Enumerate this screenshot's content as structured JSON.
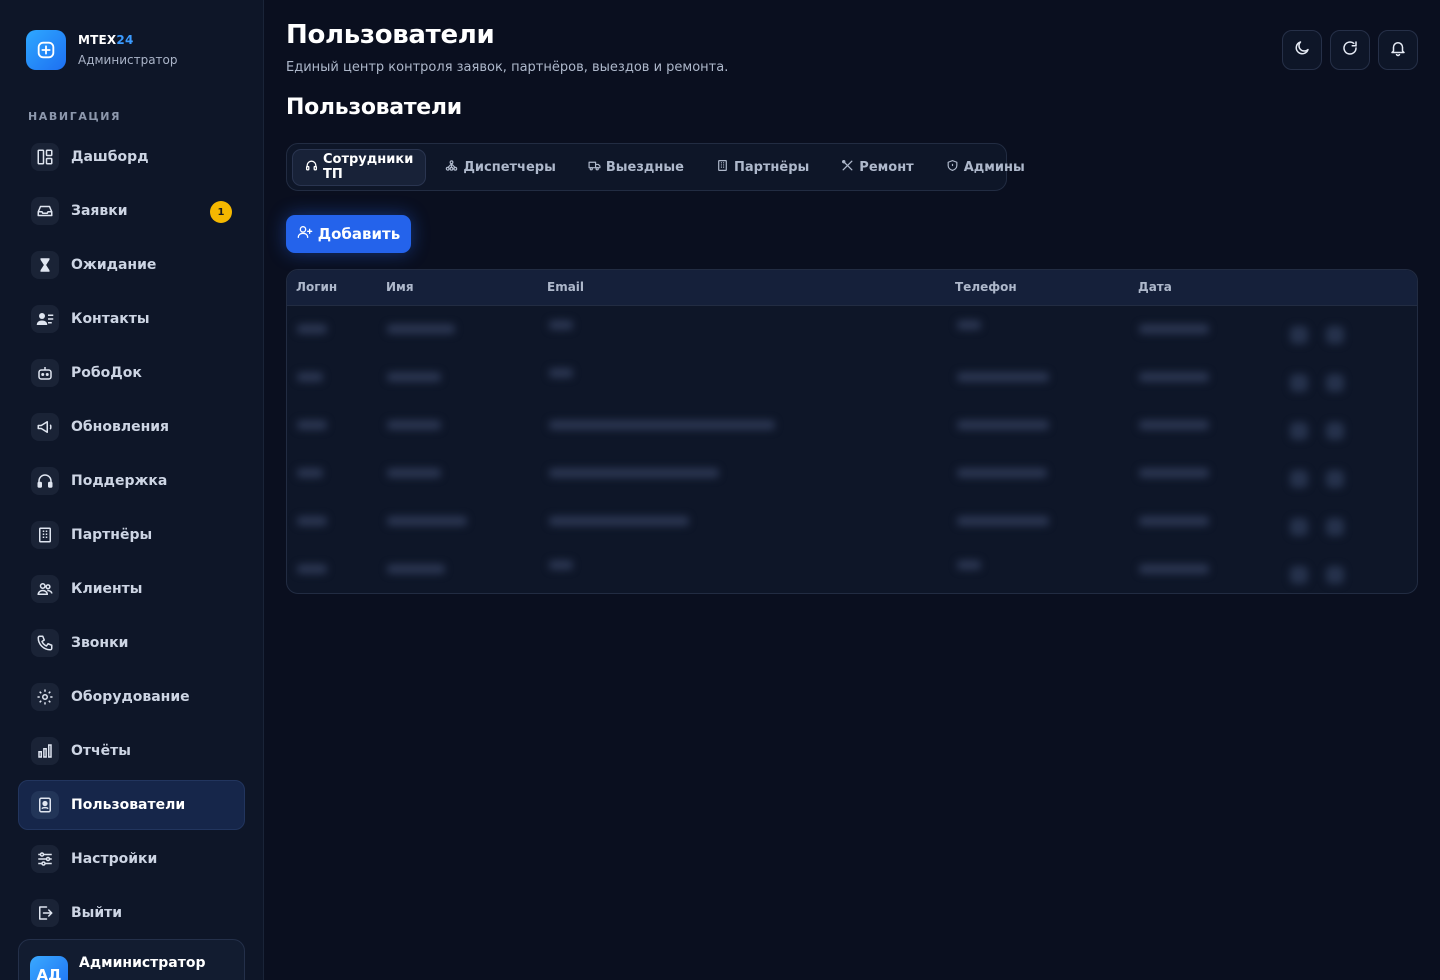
{
  "brand": {
    "name_main": "MTEX",
    "name_accent": "24",
    "role": "Администратор",
    "accent_color": "#3b9bff"
  },
  "sidebar": {
    "nav_title": "НАВИГАЦИЯ",
    "items": [
      {
        "label": "Дашборд",
        "icon": "dashboard-icon"
      },
      {
        "label": "Заявки",
        "icon": "inbox-icon",
        "badge": "1"
      },
      {
        "label": "Ожидание",
        "icon": "hourglass-icon"
      },
      {
        "label": "Контакты",
        "icon": "contacts-icon"
      },
      {
        "label": "РобоДок",
        "icon": "robot-icon"
      },
      {
        "label": "Обновления",
        "icon": "megaphone-icon"
      },
      {
        "label": "Поддержка",
        "icon": "headset-icon"
      },
      {
        "label": "Партнёры",
        "icon": "building-icon"
      },
      {
        "label": "Клиенты",
        "icon": "users-icon"
      },
      {
        "label": "Звонки",
        "icon": "phone-icon"
      },
      {
        "label": "Оборудование",
        "icon": "gear-icon"
      },
      {
        "label": "Отчёты",
        "icon": "bar-chart-icon"
      },
      {
        "label": "Пользователи",
        "icon": "user-card-icon",
        "active": true
      },
      {
        "label": "Настройки",
        "icon": "sliders-icon"
      },
      {
        "label": "Выйти",
        "icon": "logout-icon"
      }
    ],
    "user": {
      "avatar": "АД",
      "name": "Администратор"
    }
  },
  "header": {
    "title": "Пользователи",
    "subtitle": "Единый центр контроля заявок, партнёров, выездов и ремонта.",
    "actions": [
      "moon-icon",
      "refresh-icon",
      "bell-icon"
    ]
  },
  "main": {
    "section_title": "Пользователи",
    "tabs": [
      {
        "label": "Сотрудники ТП",
        "icon": "headset-icon",
        "active": true
      },
      {
        "label": "Диспетчеры",
        "icon": "network-icon"
      },
      {
        "label": "Выездные",
        "icon": "truck-icon"
      },
      {
        "label": "Партнёры",
        "icon": "building-icon"
      },
      {
        "label": "Ремонт",
        "icon": "tools-icon"
      },
      {
        "label": "Админы",
        "icon": "shield-icon"
      }
    ],
    "add_button": "Добавить",
    "table": {
      "columns": [
        "Логин",
        "Имя",
        "Email",
        "Телефон",
        "Дата"
      ],
      "row_count": 6,
      "rows_blurred": true
    }
  }
}
